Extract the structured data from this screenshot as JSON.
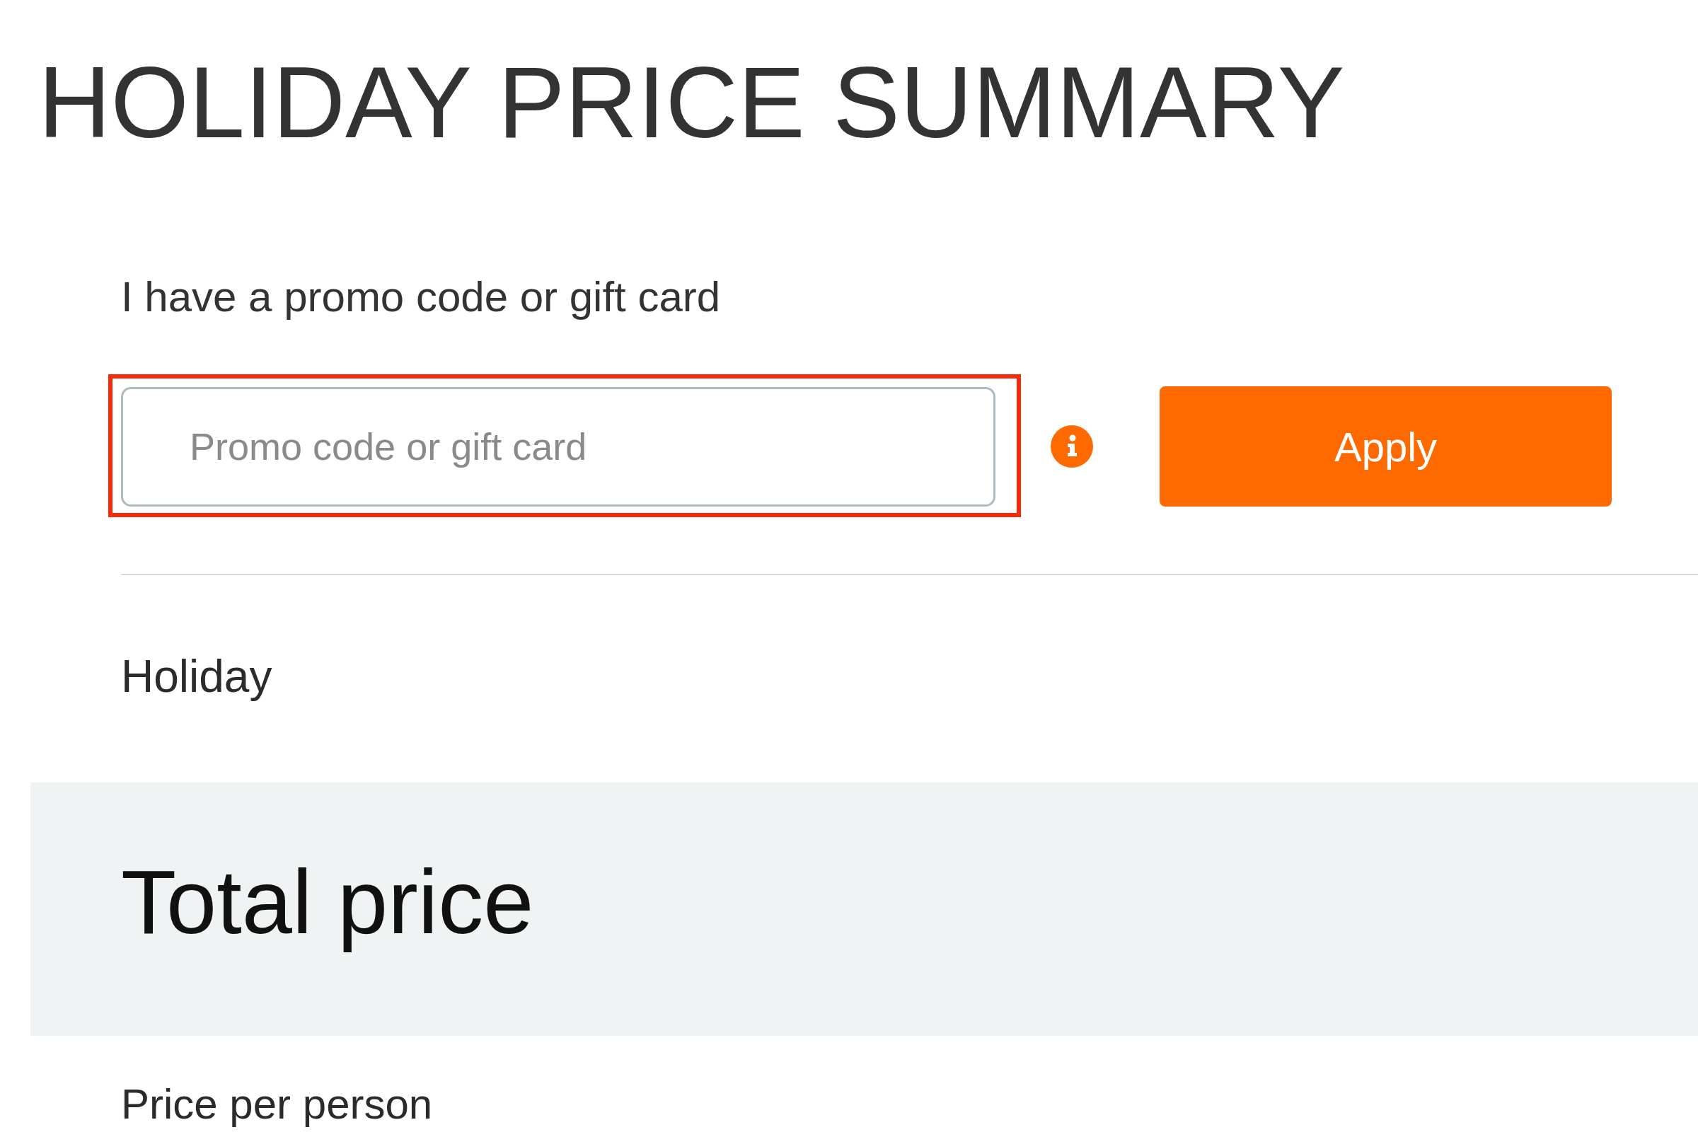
{
  "title": "HOLIDAY PRICE SUMMARY",
  "promo": {
    "label": "I have a promo code or gift card",
    "input": {
      "placeholder": "Promo code or gift card",
      "highlighted": true
    },
    "apply_button": "Apply"
  },
  "holiday": {
    "heading": "Holiday"
  },
  "total": {
    "heading": "Total price"
  },
  "price_per_person": {
    "label": "Price per person"
  }
}
